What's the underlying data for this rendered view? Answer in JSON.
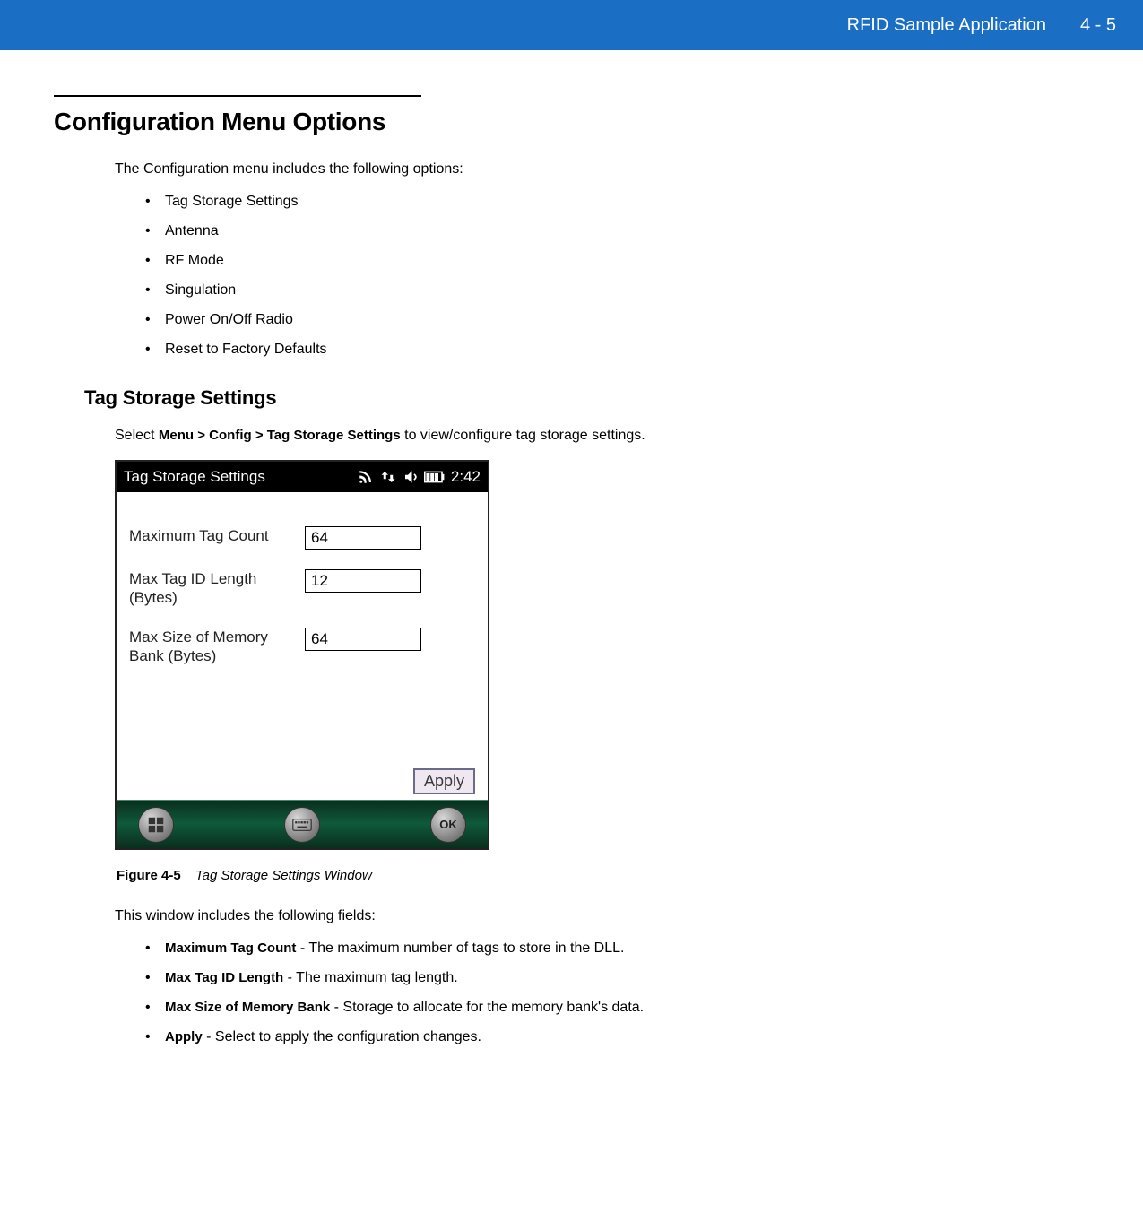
{
  "header": {
    "title": "RFID Sample Application",
    "page": "4 - 5"
  },
  "section": {
    "heading": "Configuration Menu Options",
    "intro": "The Configuration menu includes the following options:",
    "options": [
      "Tag Storage Settings",
      "Antenna",
      "RF Mode",
      "Singulation",
      "Power On/Off Radio",
      "Reset to Factory Defaults"
    ]
  },
  "subsection": {
    "heading": "Tag Storage Settings",
    "select_prefix": "Select ",
    "select_path": "Menu > Config > Tag Storage Settings",
    "select_suffix": " to view/configure tag storage settings."
  },
  "device": {
    "status_title": "Tag Storage Settings",
    "status_time": "2:42",
    "fields": [
      {
        "label": "Maximum Tag Count",
        "value": "64"
      },
      {
        "label": "Max Tag ID Length (Bytes)",
        "value": "12"
      },
      {
        "label": "Max Size of Memory Bank (Bytes)",
        "value": "64"
      }
    ],
    "apply_label": "Apply",
    "bottom_ok": "OK"
  },
  "figure": {
    "label": "Figure 4-5",
    "title": "Tag Storage Settings Window"
  },
  "fields_section": {
    "intro": "This window includes the following fields:",
    "items": [
      {
        "name": "Maximum Tag Count",
        "desc": " - The maximum number of tags to store in the DLL."
      },
      {
        "name": "Max Tag ID Length",
        "desc": " - The maximum tag length."
      },
      {
        "name": "Max Size of Memory Bank",
        "desc": " - Storage to allocate for the memory bank's data."
      },
      {
        "name": "Apply",
        "desc": " - Select to apply the configuration changes."
      }
    ]
  }
}
